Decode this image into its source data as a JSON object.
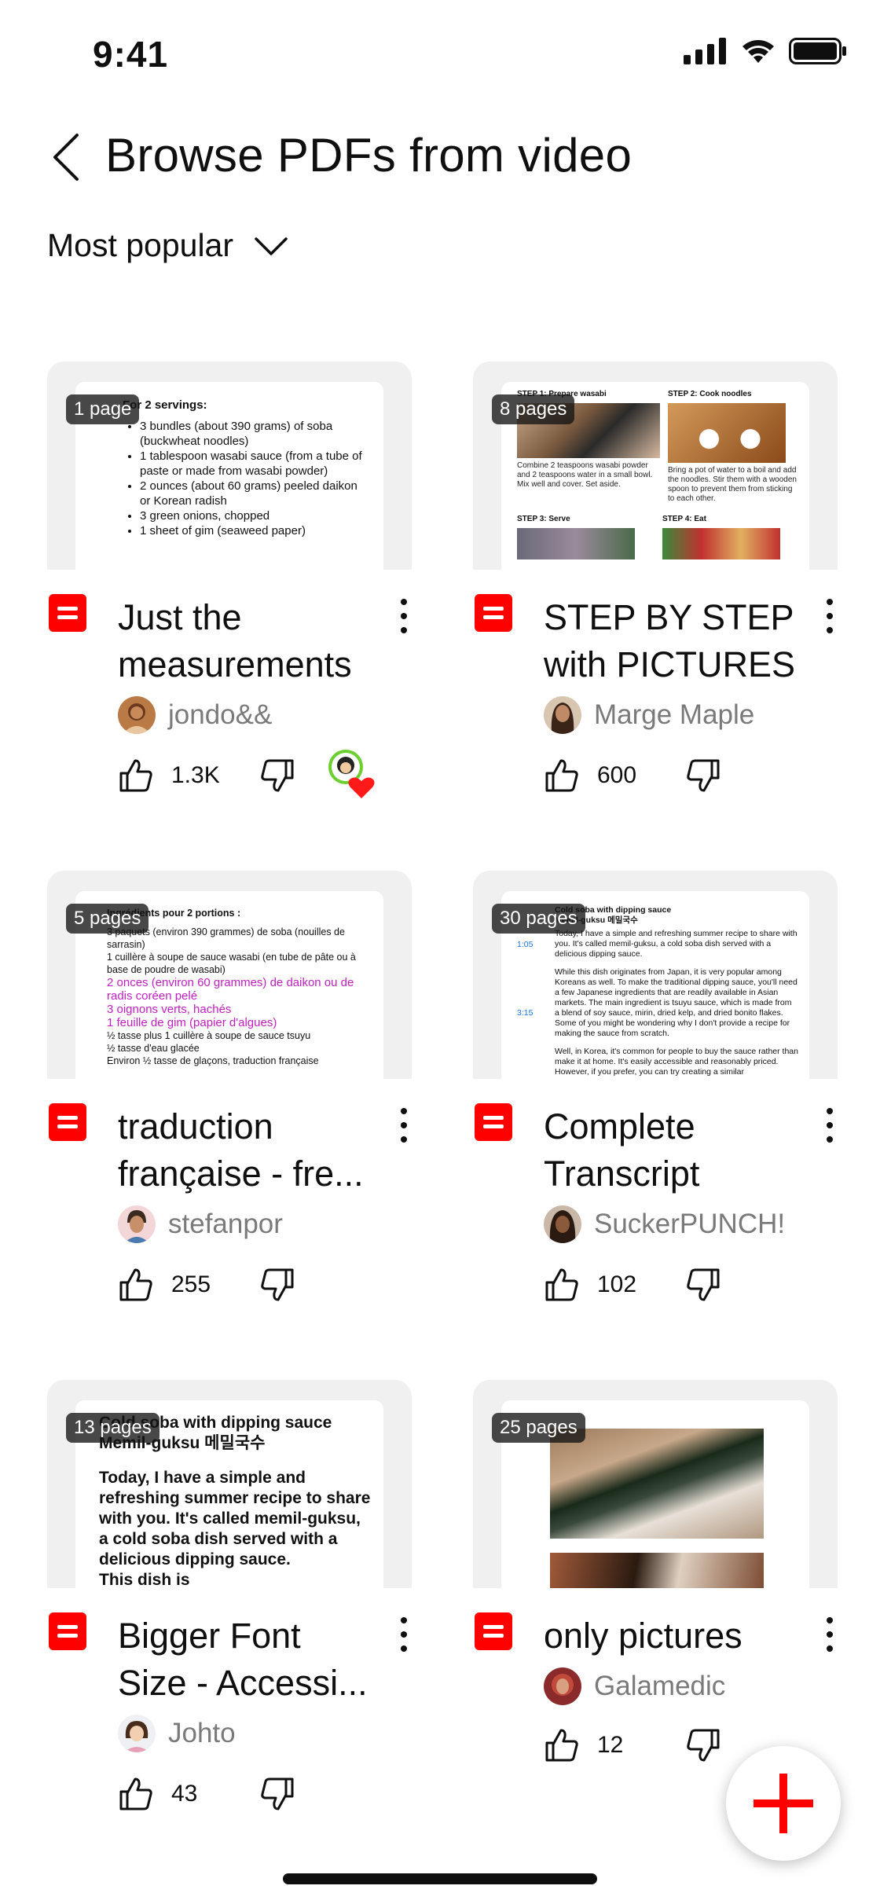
{
  "status_bar": {
    "time": "9:41"
  },
  "header": {
    "title": "Browse PDFs from video"
  },
  "sort": {
    "label": "Most popular"
  },
  "cards": [
    {
      "title": "Just the measurements",
      "badge": "1 page",
      "author": "jondo&&",
      "likes": "1.3K",
      "heart": true,
      "preview": {
        "heading": "For 2 servings:",
        "items": [
          "3 bundles (about 390 grams) of soba (buckwheat noodles)",
          "1 tablespoon wasabi sauce (from a tube of paste or made from wasabi powder)",
          "2 ounces (about 60 grams) peeled daikon or Korean radish",
          "3 green onions, chopped",
          "1 sheet of gim (seaweed paper)"
        ]
      }
    },
    {
      "title": "STEP BY STEP with PICTURES",
      "badge": "8 pages",
      "author": "Marge Maple",
      "likes": "600",
      "preview": {
        "step1": "STEP 1: Prepare wasabi",
        "step1_text": "Combine 2 teaspoons wasabi powder and 2 teaspoons water in a small bowl. Mix well and cover. Set aside.",
        "step2": "STEP 2: Cook noodles",
        "step2_text": "Bring a pot of water to a boil and add the noodles. Stir them with a wooden spoon to prevent them from sticking to each other.",
        "step3": "STEP 3: Serve",
        "step4": "STEP 4: Eat"
      }
    },
    {
      "title": "traduction française - fre...",
      "badge": "5 pages",
      "author": "stefanpor",
      "likes": "255",
      "preview": {
        "heading": "Ingrédients pour 2 portions :",
        "lines": [
          "3 paquets (environ 390 grammes) de soba (nouilles de sarrasin)",
          "1 cuillère à soupe de sauce wasabi (en tube de pâte ou à base de poudre de wasabi)"
        ],
        "magenta_lines": [
          "2 onces (environ 60 grammes) de daikon ou de radis coréen pelé",
          "3 oignons verts, hachés",
          "1 feuille de gim (papier d'algues)"
        ],
        "tail_lines": [
          "½ tasse plus 1 cuillère à soupe de sauce tsuyu",
          "½ tasse d'eau glacée",
          "Environ ½ tasse de glaçons, traduction française"
        ]
      }
    },
    {
      "title": "Complete Transcript",
      "badge": "30 pages",
      "author": "SuckerPUNCH!",
      "likes": "102",
      "preview": {
        "heading": "Cold soba with dipping sauce",
        "subheading": "Memil-guksu 메밀국수",
        "time1": "1:05",
        "time2": "3:15",
        "para1": "Today, I have a simple and refreshing summer recipe to share with you. It's called memil-guksu, a cold soba dish served with a delicious dipping sauce.",
        "para2": "While this dish originates from Japan, it is very popular among Koreans as well. To make the traditional dipping sauce, you'll need a few Japanese ingredients that are readily available in Asian markets. The main ingredient is tsuyu sauce, which is made from a blend of soy sauce, mirin, dried kelp, and dried bonito flakes. Some of you might be wondering why I don't provide a recipe for making the sauce from scratch.",
        "para3": "Well, in Korea, it's common for people to buy the sauce rather than make it at home. It's easily accessible and reasonably priced. However, if you prefer, you can try creating a similar"
      }
    },
    {
      "title": "Bigger Font Size - Accessi...",
      "badge": "13 pages",
      "author": "Johto",
      "likes": "43",
      "preview": {
        "heading": "Cold soba with dipping sauce",
        "subheading": "Memil-guksu 메밀국수",
        "para": "Today, I have a simple and refreshing summer recipe to share with you. It's called memil-guksu, a cold soba dish served with a delicious dipping sauce.",
        "tail": "This dish is"
      }
    },
    {
      "title": "only pictures",
      "badge": "25 pages",
      "author": "Galamedic",
      "likes": "12"
    }
  ],
  "colors": {
    "accent": "#ff0000",
    "text": "#0f0f0f",
    "muted": "#7a7a7a",
    "thumb_bg": "#f0f0f0"
  }
}
